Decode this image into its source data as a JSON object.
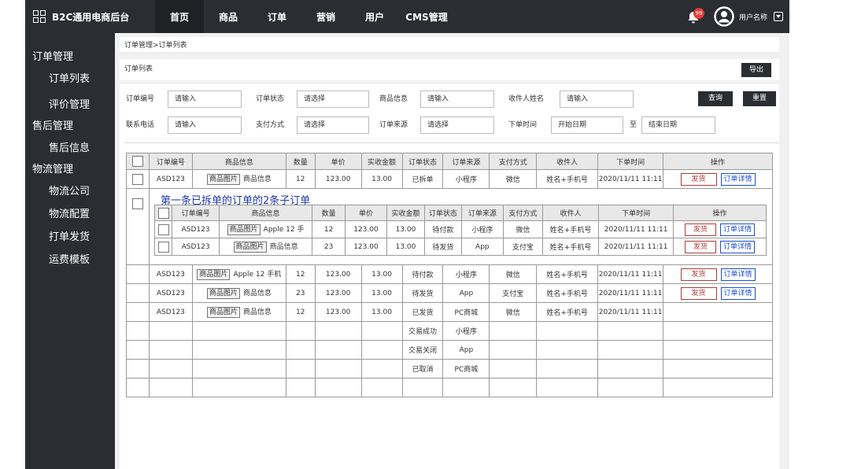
{
  "header": {
    "brand": "B2C通用电商后台",
    "nav": [
      "首页",
      "商品",
      "订单",
      "营销",
      "用户",
      "CMS管理"
    ],
    "notification_count": "99",
    "user_name": "用户名称"
  },
  "sidebar": {
    "sections": [
      {
        "title": "订单管理",
        "items": [
          "订单列表",
          "评价管理"
        ]
      },
      {
        "title": "售后管理",
        "items": [
          "售后信息"
        ]
      },
      {
        "title": "物流管理",
        "items": [
          "物流公司",
          "物流配置",
          "打单发货",
          "运费模板"
        ]
      }
    ]
  },
  "breadcrumb": "订单管理>订单列表",
  "page_title": "订单列表",
  "export_label": "导出",
  "filters": {
    "order_no_label": "订单编号",
    "order_no_placeholder": "请输入",
    "status_label": "订单状态",
    "status_placeholder": "请选择",
    "goods_label": "商品信息",
    "goods_placeholder": "请输入",
    "receiver_label": "收件人姓名",
    "receiver_placeholder": "请输入",
    "phone_label": "联系电话",
    "phone_placeholder": "请输入",
    "pay_label": "支付方式",
    "pay_placeholder": "请选择",
    "source_label": "订单来源",
    "source_placeholder": "请选择",
    "time_label": "下单时间",
    "start_placeholder": "开始日期",
    "to": "至",
    "end_placeholder": "结束日期",
    "query_label": "查询",
    "reset_label": "重置"
  },
  "table": {
    "headers": [
      "订单编号",
      "商品信息",
      "数量",
      "单价",
      "实收金额",
      "订单状态",
      "订单来源",
      "支付方式",
      "收件人",
      "下单时间",
      "操作"
    ],
    "img_label": "商品图片",
    "ship_label": "发货",
    "detail_label": "订单详情",
    "first_row": {
      "no": "ASD123",
      "goods": "商品信息",
      "qty": "12",
      "price": "123.00",
      "paid": "13.00",
      "status": "已拆单",
      "source": "小程序",
      "pay": "微信",
      "receiver": "姓名+手机号",
      "time": "2020/11/11 11:11"
    },
    "split_note": "第一条已拆单的订单的2条子订单",
    "sub_rows": [
      {
        "no": "ASD123",
        "goods": "Apple 12 手",
        "qty": "12",
        "price": "123.00",
        "paid": "13.00",
        "status": "待付款",
        "source": "小程序",
        "pay": "微信",
        "receiver": "姓名+手机号",
        "time": "2020/11/11 11:11"
      },
      {
        "no": "ASD123",
        "goods": "商品信息",
        "qty": "23",
        "price": "123.00",
        "paid": "13.00",
        "status": "待发货",
        "source": "App",
        "pay": "支付宝",
        "receiver": "姓名+手机号",
        "time": "2020/11/11 11:11"
      }
    ],
    "rows": [
      {
        "no": "ASD123",
        "goods": "Apple 12 手机",
        "qty": "12",
        "price": "123.00",
        "paid": "13.00",
        "status": "待付款",
        "source": "小程序",
        "pay": "微信",
        "receiver": "姓名+手机号",
        "time": "2020/11/11 11:11",
        "ops": true
      },
      {
        "no": "ASD123",
        "goods": "商品信息",
        "qty": "23",
        "price": "123.00",
        "paid": "13.00",
        "status": "待发货",
        "source": "App",
        "pay": "支付宝",
        "receiver": "姓名+手机号",
        "time": "2020/11/11 11:11",
        "ops": true
      },
      {
        "no": "ASD123",
        "goods": "商品信息",
        "qty": "12",
        "price": "123.00",
        "paid": "13.00",
        "status": "已发货",
        "source": "PC商城",
        "pay": "微信",
        "receiver": "姓名+手机号",
        "time": "2020/11/11 11:11",
        "ops": false
      }
    ],
    "status_only_rows": [
      {
        "status": "交易成功",
        "source": "小程序"
      },
      {
        "status": "交易关闭",
        "source": "App"
      },
      {
        "status": "已取消",
        "source": "PC商城"
      },
      {
        "status": "",
        "source": ""
      }
    ]
  }
}
